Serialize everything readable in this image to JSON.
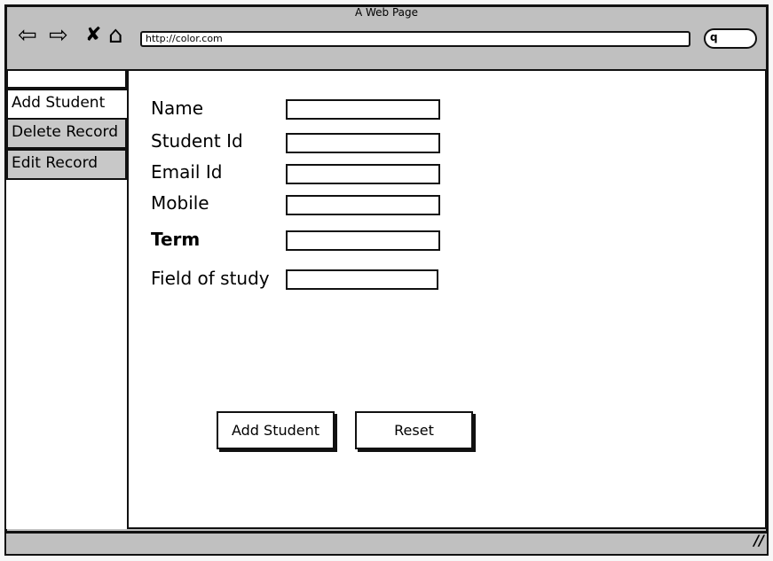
{
  "browser": {
    "title": "A Web Page",
    "url": "http://color.com",
    "icons": [
      "back-arrow-icon",
      "forward-arrow-icon",
      "close-icon",
      "home-icon",
      "search-icon",
      "resize-grip-icon"
    ]
  },
  "sidebar": {
    "items": [
      {
        "label": "Add Student",
        "selected": true
      },
      {
        "label": "Delete Record",
        "selected": false
      },
      {
        "label": "Edit Record",
        "selected": false
      }
    ]
  },
  "form": {
    "fields": [
      {
        "label": "Name",
        "value": ""
      },
      {
        "label": "Student Id",
        "value": ""
      },
      {
        "label": "Email Id",
        "value": ""
      },
      {
        "label": "Mobile",
        "value": ""
      },
      {
        "label": "Term",
        "value": ""
      },
      {
        "label": "Field of study",
        "value": ""
      }
    ],
    "add_button": "Add Student",
    "reset_button": "Reset"
  }
}
